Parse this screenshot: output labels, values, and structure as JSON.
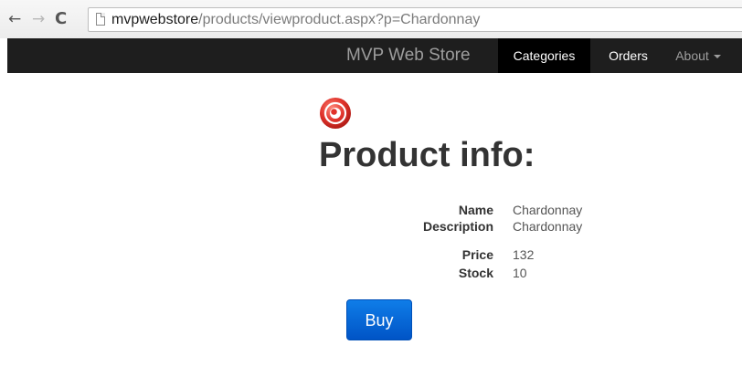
{
  "browser": {
    "back_icon": "arrow-left-icon",
    "forward_icon": "arrow-right-icon",
    "reload_icon": "reload-icon",
    "url_host": "mvpwebstore",
    "url_path": "/products/viewproduct.aspx?p=Chardonnay"
  },
  "navbar": {
    "brand": "MVP Web Store",
    "items": [
      {
        "label": "Categories",
        "active": true
      },
      {
        "label": "Orders",
        "active": false
      },
      {
        "label": "About",
        "active": false,
        "dropdown": true
      }
    ],
    "colors": {
      "background": "#1e1e1e",
      "active": "#000000",
      "text": "#ffffff",
      "muted": "#9d9d9d"
    }
  },
  "product": {
    "logo_icon": "record-icon",
    "title": "Product info:",
    "fields": [
      {
        "label": "Name",
        "value": "Chardonnay"
      },
      {
        "label": "Description",
        "value": "Chardonnay"
      },
      {
        "label": "Price",
        "value": "132"
      },
      {
        "label": "Stock",
        "value": "10"
      }
    ],
    "buy_label": "Buy",
    "colors": {
      "buy_button": "#0a6fde",
      "logo": "#e8413b"
    }
  }
}
